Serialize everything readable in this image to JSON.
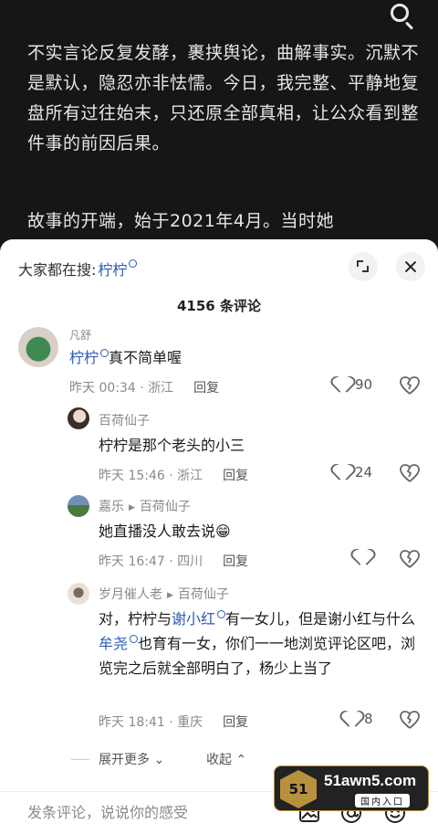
{
  "article": {
    "para1": "不实言论反复发酵，裹挟舆论，曲解事实。沉默不是默认，隐忍亦非怯懦。今日，我完整、平静地复盘所有过往始末，只还原全部真相，让公众看到整件事的前因后果。",
    "para2": "故事的开端，始于2021年4月。当时她"
  },
  "sheet": {
    "hot_label": "大家都在搜:",
    "hot_keyword": "柠柠",
    "comment_count": "4156 条评论"
  },
  "comments": [
    {
      "user": "凡舒",
      "text_link": "柠柠",
      "text": "真不简单喔",
      "time": "昨天 00:34 · 浙江",
      "reply": "回复",
      "likes": "90"
    },
    {
      "user": "百荷仙子",
      "text": "柠柠是那个老头的小三",
      "time": "昨天 15:46 · 浙江",
      "reply": "回复",
      "likes": "24"
    },
    {
      "user": "嘉乐",
      "reply_to": "百荷仙子",
      "text": "她直播没人敢去说😁",
      "time": "昨天 16:47 · 四川",
      "reply": "回复",
      "likes": ""
    },
    {
      "user": "岁月催人老",
      "reply_to": "百荷仙子",
      "text_a": "对，柠柠与",
      "link_a": "谢小红",
      "text_b": "有一女儿，但是谢小红与什么",
      "link_b": "牟尧",
      "text_c": "也育有一女，你们一一地浏览评论区吧，浏览完之后就全部明白了，杨少上当了",
      "time": "昨天 18:41 · 重庆",
      "reply": "回复",
      "likes": "8"
    }
  ],
  "expand_more": "展开更多",
  "collapse": "收起",
  "input": {
    "placeholder": "发条评论，说说你的感受"
  },
  "watermark": {
    "logo": "51",
    "site": "51awn5.com",
    "entry": "国内入口"
  },
  "colors": {
    "link": "#2b5bb4",
    "article_bg": "#161616"
  }
}
